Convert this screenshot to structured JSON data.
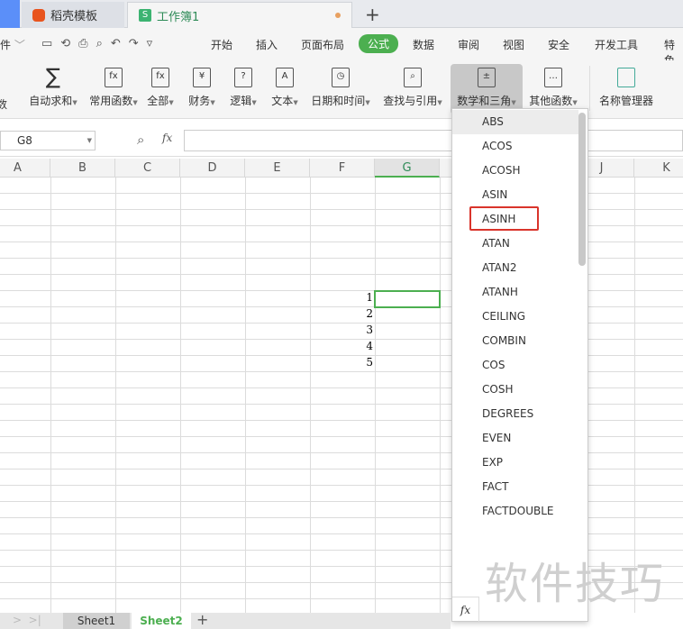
{
  "tabs": [
    {
      "label": "稻壳模板"
    },
    {
      "label": "工作簿1"
    }
  ],
  "file_menu": "件",
  "menus": [
    "开始",
    "插入",
    "页面布局",
    "公式",
    "数据",
    "审阅",
    "视图",
    "安全",
    "开发工具",
    "特色"
  ],
  "active_menu": "公式",
  "ribbon": [
    {
      "label": "数",
      "icon": "insert-function-icon"
    },
    {
      "label": "自动求和",
      "icon": "sigma-icon"
    },
    {
      "label": "常用函数",
      "icon": "fx-star-icon"
    },
    {
      "label": "全部",
      "icon": "fx-icon"
    },
    {
      "label": "财务",
      "icon": "yen-book-icon"
    },
    {
      "label": "逻辑",
      "icon": "question-book-icon"
    },
    {
      "label": "文本",
      "icon": "a-book-icon"
    },
    {
      "label": "日期和时间",
      "icon": "clock-book-icon"
    },
    {
      "label": "查找与引用",
      "icon": "search-book-icon"
    },
    {
      "label": "数学和三角",
      "icon": "plus-minus-book-icon"
    },
    {
      "label": "其他函数",
      "icon": "dots-book-icon"
    },
    {
      "label": "名称管理器",
      "icon": "name-manager-icon"
    }
  ],
  "name_box": "G8",
  "fx_label": "fx",
  "columns": [
    "A",
    "B",
    "C",
    "D",
    "E",
    "F",
    "G",
    "H",
    "I",
    "J",
    "K"
  ],
  "cell_values": [
    "1",
    "2",
    "3",
    "4",
    "5"
  ],
  "dropdown": {
    "items": [
      "ABS",
      "ACOS",
      "ACOSH",
      "ASIN",
      "ASINH",
      "ATAN",
      "ATAN2",
      "ATANH",
      "CEILING",
      "COMBIN",
      "COS",
      "COSH",
      "DEGREES",
      "EVEN",
      "EXP",
      "FACT",
      "FACTDOUBLE"
    ],
    "highlighted": "ASINH",
    "hovered": "ABS",
    "footer": "fx"
  },
  "sheets": [
    "Sheet1",
    "Sheet2"
  ],
  "active_sheet": "Sheet2",
  "watermark": "软件技巧",
  "colors": {
    "accent": "#4caf50",
    "highlight_box": "#d9342b"
  }
}
